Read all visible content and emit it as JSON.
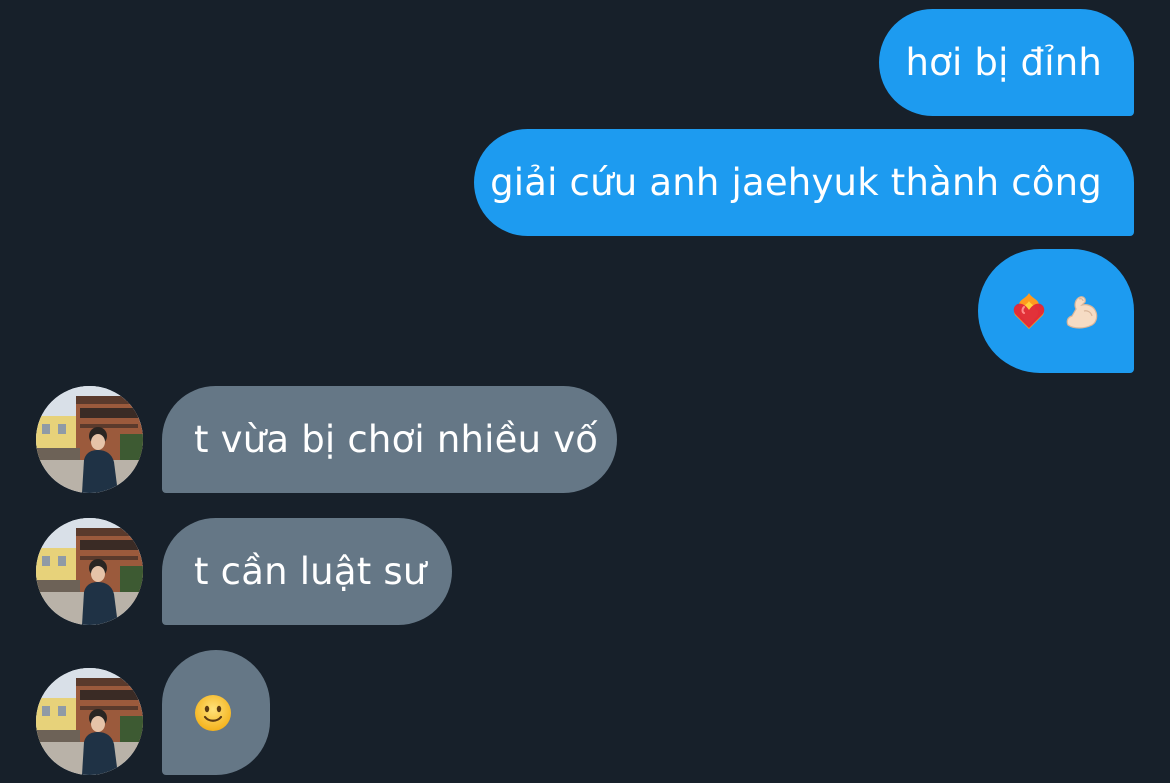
{
  "conversation": {
    "messages": [
      {
        "side": "sent",
        "text": "hơi bị đỉnh"
      },
      {
        "side": "sent",
        "text": "giải cứu anh jaehyuk thành công"
      },
      {
        "side": "sent",
        "emojis": [
          "heart-on-fire-icon",
          "flexed-biceps-icon"
        ]
      },
      {
        "side": "received",
        "text": "t vừa bị chơi nhiều vố"
      },
      {
        "side": "received",
        "text": "t cần luật sư"
      },
      {
        "side": "received",
        "emojis": [
          "slightly-smiling-face-icon"
        ]
      }
    ]
  },
  "colors": {
    "background": "#17202a",
    "sent_bubble": "#1d9bf0",
    "received_bubble": "#657786"
  }
}
